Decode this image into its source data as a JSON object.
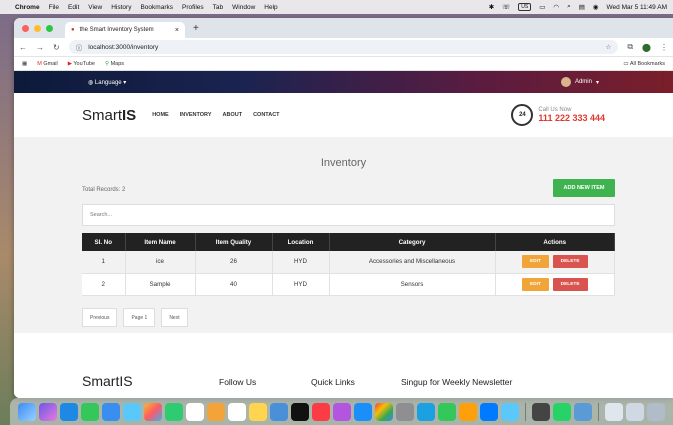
{
  "menubar": {
    "app": "Chrome",
    "items": [
      "File",
      "Edit",
      "View",
      "History",
      "Bookmarks",
      "Profiles",
      "Tab",
      "Window",
      "Help"
    ],
    "input_source": "US",
    "clock": "Wed Mar 5 11:49 AM"
  },
  "browser": {
    "tab_title": "the Smart Inventory System",
    "tab_close": "×",
    "new_tab": "+",
    "url": "localhost:3000/inventory",
    "bookmarks": [
      "Gmail",
      "YouTube",
      "Maps"
    ],
    "all_bookmarks": "All Bookmarks"
  },
  "topbar": {
    "language": "Language",
    "admin": "Admin"
  },
  "header": {
    "logo_bold": "Smart",
    "logo_rest": "IS",
    "nav": [
      "HOME",
      "INVENTORY",
      "ABOUT",
      "CONTACT"
    ],
    "call_badge": "24",
    "call_label": "Call Us Now",
    "call_number": "111 222 333 444"
  },
  "inventory": {
    "title": "Inventory",
    "total_records": "Total Records: 2",
    "add_button": "ADD NEW ITEM",
    "search_placeholder": "Search...",
    "columns": [
      "Sl. No",
      "Item Name",
      "Item Quality",
      "Location",
      "Category",
      "Actions"
    ],
    "rows": [
      {
        "sl": "1",
        "name": "ice",
        "quality": "26",
        "location": "HYD",
        "category": "Accessories and Miscellaneous"
      },
      {
        "sl": "2",
        "name": "Sample",
        "quality": "40",
        "location": "HYD",
        "category": "Sensors"
      }
    ],
    "edit_label": "EDIT",
    "delete_label": "DELETE",
    "pager": {
      "previous": "Previous",
      "page": "Page 1",
      "next": "Next"
    }
  },
  "footer": {
    "logo": "SmartIS",
    "follow": "Follow Us",
    "quick_links": "Quick Links",
    "newsletter": "Singup for Weekly Newsletter"
  },
  "colors": {
    "accent_green": "#3fb34f",
    "edit_orange": "#f0a43a",
    "delete_red": "#d9534f",
    "call_number_red": "#e0382d"
  }
}
